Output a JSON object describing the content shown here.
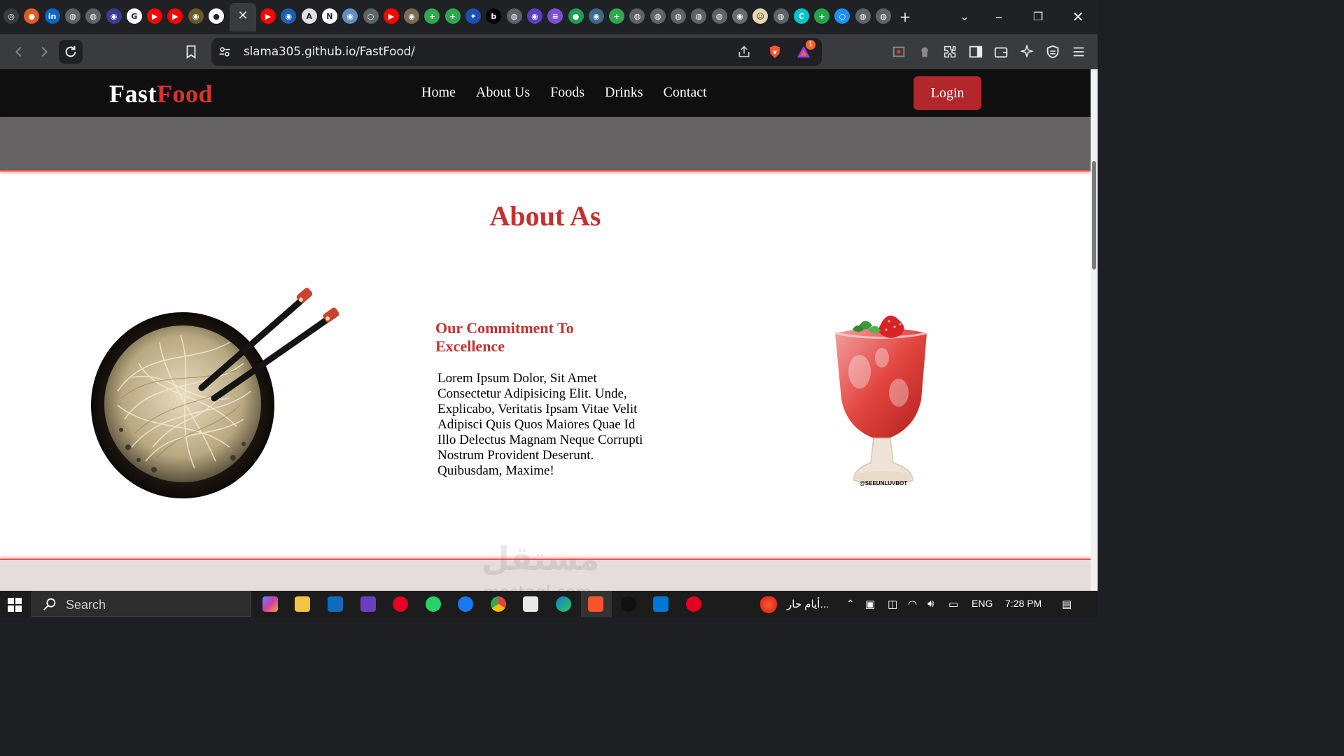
{
  "browser": {
    "tab_favicons": [
      {
        "name": "openai-icon",
        "color": "#3a3b3f",
        "glyph": "◎"
      },
      {
        "name": "firefox-icon",
        "color": "#e05a22",
        "glyph": "●"
      },
      {
        "name": "linkedin-icon",
        "color": "#0a66c2",
        "glyph": "in"
      },
      {
        "name": "globe-icon",
        "color": "#5f6368",
        "glyph": "◍"
      },
      {
        "name": "globe-icon",
        "color": "#5f6368",
        "glyph": "◍"
      },
      {
        "name": "site-icon",
        "color": "#3b3c8f",
        "glyph": "◉"
      },
      {
        "name": "google-icon",
        "color": "#ffffff",
        "glyph": "G"
      },
      {
        "name": "youtube-icon",
        "color": "#ff0000",
        "glyph": "▶"
      },
      {
        "name": "youtube-icon",
        "color": "#ff0000",
        "glyph": "▶"
      },
      {
        "name": "site-icon",
        "color": "#6a5a2a",
        "glyph": "◉"
      },
      {
        "name": "github-icon",
        "color": "#ffffff",
        "glyph": "●"
      }
    ],
    "tab_favicons_right": [
      {
        "name": "youtube-icon",
        "color": "#ff0000",
        "glyph": "▶"
      },
      {
        "name": "site-icon",
        "color": "#1a5fb4",
        "glyph": "◉"
      },
      {
        "name": "site-icon",
        "color": "#e0e0e0",
        "glyph": "A"
      },
      {
        "name": "notion-icon",
        "color": "#ffffff",
        "glyph": "N"
      },
      {
        "name": "site-icon",
        "color": "#5f8fbf",
        "glyph": "◉"
      },
      {
        "name": "loading-icon",
        "color": "#5f6368",
        "glyph": "○"
      },
      {
        "name": "youtube-icon",
        "color": "#ff0000",
        "glyph": "▶"
      },
      {
        "name": "site-icon",
        "color": "#7a6a5a",
        "glyph": "◉"
      },
      {
        "name": "site-icon",
        "color": "#2fa84f",
        "glyph": "+"
      },
      {
        "name": "site-icon",
        "color": "#2fa84f",
        "glyph": "+"
      },
      {
        "name": "site-icon",
        "color": "#1a4fb4",
        "glyph": "✦"
      },
      {
        "name": "site-icon",
        "color": "#000000",
        "glyph": "b"
      },
      {
        "name": "globe-icon",
        "color": "#5f6368",
        "glyph": "◍"
      },
      {
        "name": "site-icon",
        "color": "#5a3fbf",
        "glyph": "◉"
      },
      {
        "name": "site-icon",
        "color": "#7b4fd6",
        "glyph": "≡"
      },
      {
        "name": "site-icon",
        "color": "#1f9d55",
        "glyph": "●"
      },
      {
        "name": "site-icon",
        "color": "#3a6a8a",
        "glyph": "◉"
      },
      {
        "name": "site-icon",
        "color": "#2fa84f",
        "glyph": "+"
      },
      {
        "name": "globe-icon",
        "color": "#5f6368",
        "glyph": "◍"
      },
      {
        "name": "globe-icon",
        "color": "#5f6368",
        "glyph": "◍"
      },
      {
        "name": "globe-icon",
        "color": "#5f6368",
        "glyph": "◍"
      },
      {
        "name": "globe-icon",
        "color": "#5f6368",
        "glyph": "◍"
      },
      {
        "name": "globe-icon",
        "color": "#5f6368",
        "glyph": "◍"
      },
      {
        "name": "site-icon",
        "color": "#6a6a6a",
        "glyph": "◉"
      },
      {
        "name": "site-icon",
        "color": "#e8d9b0",
        "glyph": "☺"
      },
      {
        "name": "globe-icon",
        "color": "#5f6368",
        "glyph": "◍"
      },
      {
        "name": "canva-icon",
        "color": "#00c4cc",
        "glyph": "C"
      },
      {
        "name": "site-icon",
        "color": "#22a447",
        "glyph": "+"
      },
      {
        "name": "site-icon",
        "color": "#1e90ff",
        "glyph": "○"
      },
      {
        "name": "globe-icon",
        "color": "#5f6368",
        "glyph": "◍"
      },
      {
        "name": "globe-icon",
        "color": "#5f6368",
        "glyph": "◍"
      }
    ],
    "url": "slama305.github.io/FastFood/",
    "notification_count": "1"
  },
  "site": {
    "logo_part1": "Fast",
    "logo_part2": "Food",
    "nav": [
      "Home",
      "About Us",
      "Foods",
      "Drinks",
      "Contact"
    ],
    "login_label": "Login",
    "section_title": "About As",
    "commitment_title": "Our Commitment To Excellence",
    "commitment_text": "Lorem Ipsum Dolor, Sit Amet Consectetur Adipisicing Elit. Unde, Explicabo, Veritatis Ipsam Vitae Velit Adipisci Quis Quos Maiores Quae Id Illo Delectus Magnam Neque Corrupti Nostrum Provident Deserunt. Quibusdam, Maxime!",
    "drink_caption": "@SEEUNLUVBOT",
    "accent_color": "#c8302d"
  },
  "watermark": {
    "main": "مستقل",
    "sub": "mostaql.com"
  },
  "taskbar": {
    "search_label": "Search",
    "weather_text": "أيام حار...",
    "language": "ENG",
    "time": "7:28 PM"
  }
}
